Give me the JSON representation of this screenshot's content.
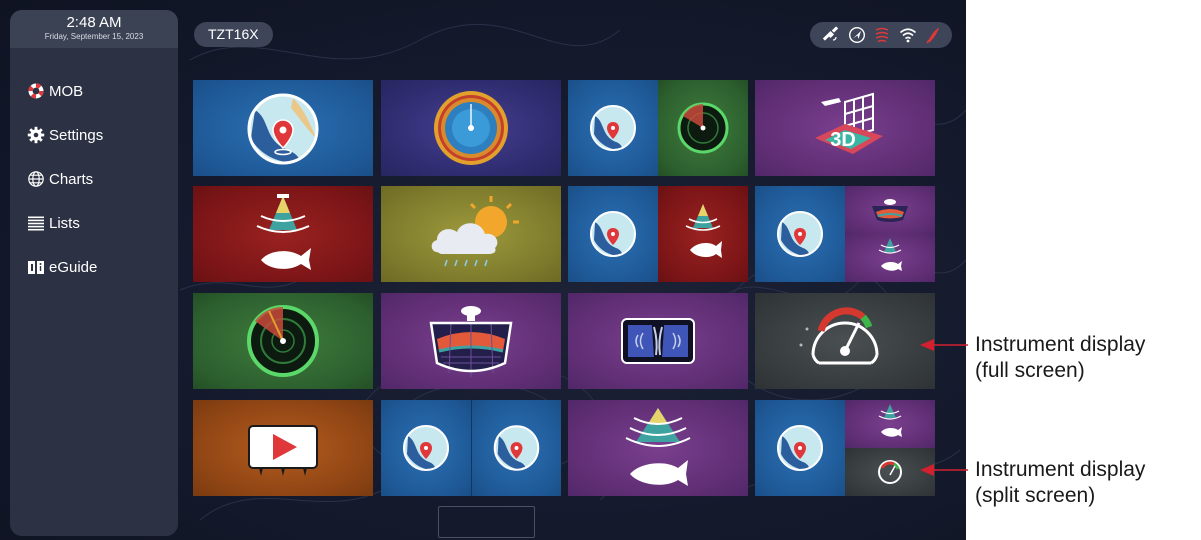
{
  "sidebar": {
    "time": "2:48 AM",
    "date": "Friday, September 15, 2023",
    "items": [
      {
        "label": "MOB",
        "icon": "lifebuoy-icon"
      },
      {
        "label": "Settings",
        "icon": "gear-icon"
      },
      {
        "label": "Charts",
        "icon": "globe-icon"
      },
      {
        "label": "Lists",
        "icon": "list-icon"
      },
      {
        "label": "eGuide",
        "icon": "book-icon"
      }
    ]
  },
  "topbar": {
    "model": "TZT16X",
    "status_icons": [
      "satellite-icon",
      "navigation-icon",
      "sonar-icon",
      "wifi-icon",
      "bluetooth-icon"
    ],
    "status_colors": {
      "sonar": "#e0383a",
      "bluetooth": "#e0383a"
    }
  },
  "tiles": [
    {
      "id": "chart",
      "icons": [
        "chart-icon"
      ]
    },
    {
      "id": "radar-overlay",
      "icons": [
        "radar-overlay-icon"
      ]
    },
    {
      "id": "chart-radar",
      "icons": [
        "chart-icon",
        "radar-icon"
      ]
    },
    {
      "id": "3d",
      "icons": [
        "3d-sounder-icon"
      ],
      "text": "3D"
    },
    {
      "id": "fish-finder",
      "icons": [
        "fish-finder-icon"
      ]
    },
    {
      "id": "weather",
      "icons": [
        "weather-icon"
      ]
    },
    {
      "id": "chart-fish-finder",
      "icons": [
        "chart-icon",
        "fish-finder-icon"
      ]
    },
    {
      "id": "chart-sonar-fish",
      "icons": [
        "chart-icon",
        "sonar-icon",
        "fish-finder-icon"
      ]
    },
    {
      "id": "radar",
      "icons": [
        "radar-icon"
      ]
    },
    {
      "id": "sonar",
      "icons": [
        "sonar-icon"
      ]
    },
    {
      "id": "side-scan",
      "icons": [
        "side-scan-icon"
      ]
    },
    {
      "id": "instrument-full",
      "icons": [
        "gauge-icon"
      ]
    },
    {
      "id": "video",
      "icons": [
        "video-play-icon"
      ]
    },
    {
      "id": "chart-chart",
      "icons": [
        "chart-icon",
        "chart-icon"
      ]
    },
    {
      "id": "fish-finder-wide",
      "icons": [
        "fish-finder-icon"
      ]
    },
    {
      "id": "chart-fish-instrument",
      "icons": [
        "chart-icon",
        "fish-finder-icon",
        "gauge-icon"
      ]
    }
  ],
  "callouts": [
    {
      "line1": "Instrument display",
      "line2": "(full screen)"
    },
    {
      "line1": "Instrument display",
      "line2": "(split screen)"
    }
  ],
  "colors": {
    "background": "#141a2c",
    "sidebar": "#2c3243",
    "tile_blue": "#1f5a98",
    "tile_purple": "#5d2d72",
    "tile_red": "#7c1517",
    "tile_green": "#2c5f2e",
    "accent_red": "#e0383a"
  }
}
